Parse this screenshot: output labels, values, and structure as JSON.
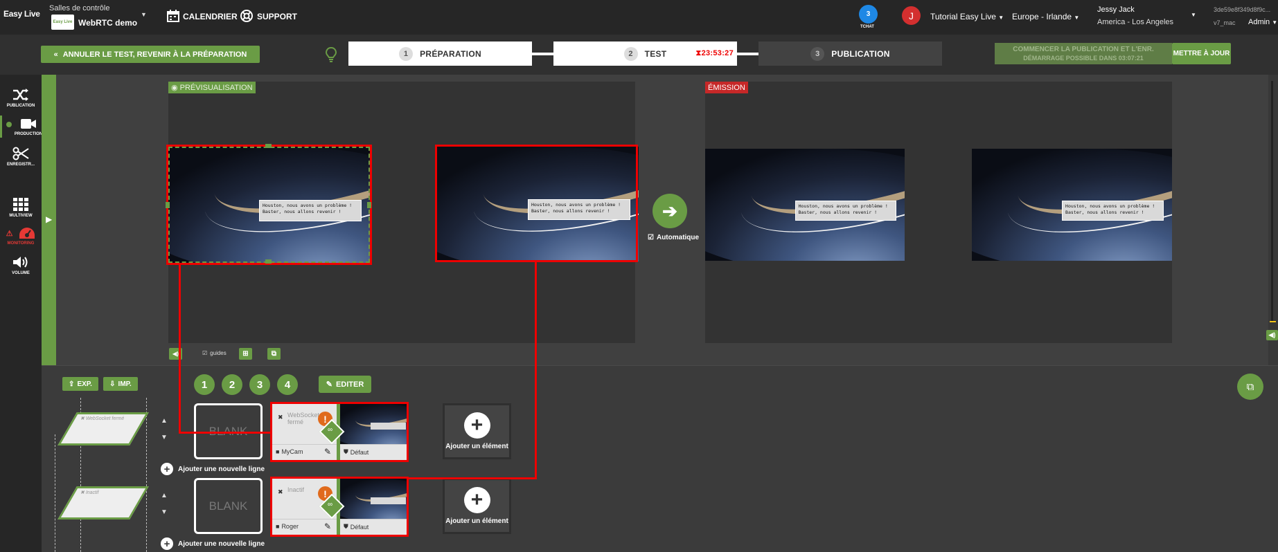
{
  "topbar": {
    "logo": "Easy Live",
    "control_room_label": "Salles de contrôle",
    "room_name": "WebRTC demo",
    "room_logo": "Easy Live",
    "calendar": "CALENDRIER",
    "support": "SUPPORT",
    "chat_count": "3",
    "chat_label": "TCHAT",
    "avatar_letter": "J",
    "account": "Tutorial Easy Live",
    "region": "Europe - Irlande",
    "user_name": "Jessy Jack",
    "timezone": "America - Los Angeles",
    "session_id": "3de59e8f349d8f9c...",
    "version": "v7_mac",
    "role": "Admin"
  },
  "bar2": {
    "cancel_test": "ANNULER LE TEST, REVENIR À LA PRÉPARATION",
    "steps": [
      {
        "num": "1",
        "label": "PRÉPARATION"
      },
      {
        "num": "2",
        "label": "TEST",
        "timer": "23:53:27"
      },
      {
        "num": "3",
        "label": "PUBLICATION"
      }
    ],
    "start_pub_line1": "COMMENCER LA PUBLICATION ET L'ENR.",
    "start_pub_line2": "DÉMARRAGE POSSIBLE DANS 03:07:21",
    "update": "METTRE À JOUR"
  },
  "sidebar": {
    "items": [
      {
        "label": "PUBLICATION",
        "icon": "shuffle-icon"
      },
      {
        "label": "PRODUCTION",
        "icon": "camera-icon"
      },
      {
        "label": "ENREGISTR...",
        "icon": "scissors-icon"
      },
      {
        "label": "MULTIVIEW",
        "icon": "grid-icon"
      },
      {
        "label": "MONITORING",
        "icon": "gauge-icon"
      },
      {
        "label": "VOLUME",
        "icon": "speaker-icon"
      }
    ]
  },
  "preview": {
    "label": "PRÉVISUALISATION",
    "bubble_line1": "Houston, nous avons un problème !",
    "bubble_line2": "Baster, nous allons revenir !",
    "guides_label": "guides"
  },
  "emission": {
    "label": "ÉMISSION",
    "auto_label": "Automatique"
  },
  "lower": {
    "exp": "EXP.",
    "imp": "IMP.",
    "layouts": [
      "1",
      "2",
      "3",
      "4"
    ],
    "edit": "EDITER",
    "add_line": "Ajouter une nouvelle ligne",
    "add_element": "Ajouter un élément",
    "blank": "BLANK",
    "rows": [
      {
        "status": "WebSocket fermé",
        "source": "MyCam",
        "profile": "Défaut",
        "para_label": "WebSocket fermé"
      },
      {
        "status": "Inactif",
        "source": "Roger",
        "profile": "Défaut",
        "para_label": "Inactif"
      }
    ]
  },
  "colors": {
    "accent": "#6a9c45",
    "alert": "#e00000",
    "warning": "#e06a1c",
    "blue": "#1e88e5"
  }
}
